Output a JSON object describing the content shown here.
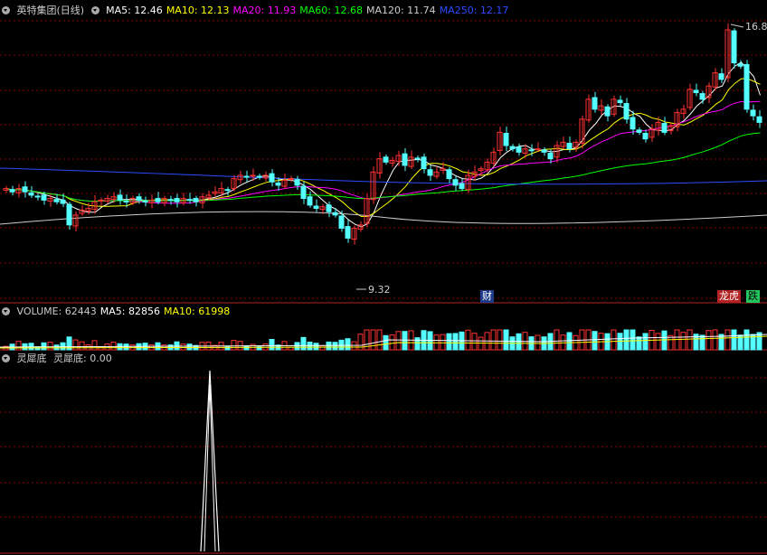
{
  "header": {
    "stock_name": "英特集团(日线)",
    "ma_labels": [
      {
        "text": "MA5: 12.46",
        "color": "#ffffff"
      },
      {
        "text": "MA10: 12.13",
        "color": "#ffff00"
      },
      {
        "text": "MA20: 11.93",
        "color": "#ff00ff"
      },
      {
        "text": "MA60: 12.68",
        "color": "#00ff00"
      },
      {
        "text": "MA120: 11.74",
        "color": "#cccccc"
      },
      {
        "text": "MA250: 12.17",
        "color": "#2b4bff"
      }
    ]
  },
  "price_panel": {
    "high_label": "16.89",
    "low_label": "9.32",
    "markers": {
      "cai": "财",
      "longhu": "龙虎",
      "die": "跌"
    }
  },
  "volume_panel": {
    "labels": [
      {
        "text": "VOLUME: 62443",
        "color": "#cccccc"
      },
      {
        "text": "MA5: 82856",
        "color": "#ffffff"
      },
      {
        "text": "MA10: 61998",
        "color": "#ffff00"
      }
    ]
  },
  "indicator_panel": {
    "title": "灵犀底",
    "value_label": "灵犀底: 0.00"
  },
  "colors": {
    "up": "#ff3232",
    "down": "#54ffff",
    "grid": "#8b0000",
    "ma5": "#ffffff",
    "ma10": "#ffff00",
    "ma20": "#ff00ff",
    "ma60": "#00ff00",
    "ma120": "#cccccc",
    "ma250": "#2b4bff"
  },
  "chart_data": {
    "type": "candlestick",
    "closes": [
      12.1,
      12.0,
      12.1,
      12.0,
      11.9,
      11.85,
      11.75,
      11.8,
      11.7,
      11.65,
      11.0,
      11.3,
      11.45,
      11.5,
      11.7,
      11.75,
      11.8,
      11.85,
      11.75,
      11.7,
      11.8,
      11.75,
      11.7,
      11.75,
      11.7,
      11.8,
      11.75,
      11.7,
      11.8,
      11.75,
      11.7,
      11.85,
      11.9,
      12.0,
      12.1,
      12.05,
      12.4,
      12.5,
      12.45,
      12.5,
      12.45,
      12.5,
      12.3,
      12.2,
      12.35,
      12.4,
      12.2,
      11.8,
      11.6,
      11.5,
      11.55,
      11.4,
      11.3,
      10.9,
      10.6,
      10.9,
      11.0,
      11.8,
      12.6,
      13.0,
      12.9,
      12.95,
      13.1,
      12.8,
      13.05,
      13.0,
      12.7,
      12.5,
      12.6,
      12.7,
      12.4,
      12.2,
      12.1,
      12.5,
      12.6,
      12.7,
      12.9,
      13.2,
      13.8,
      13.4,
      13.3,
      13.2,
      13.3,
      13.25,
      13.3,
      13.2,
      13.0,
      13.4,
      13.5,
      13.3,
      13.5,
      14.2,
      14.8,
      14.5,
      14.6,
      14.3,
      14.8,
      14.7,
      14.2,
      13.9,
      13.8,
      13.6,
      13.9,
      14.1,
      13.8,
      14.0,
      14.4,
      14.5,
      15.1,
      15.0,
      14.8,
      15.2,
      15.6,
      15.4,
      16.9,
      15.9,
      15.8,
      14.5,
      14.3,
      14.1
    ]
  }
}
